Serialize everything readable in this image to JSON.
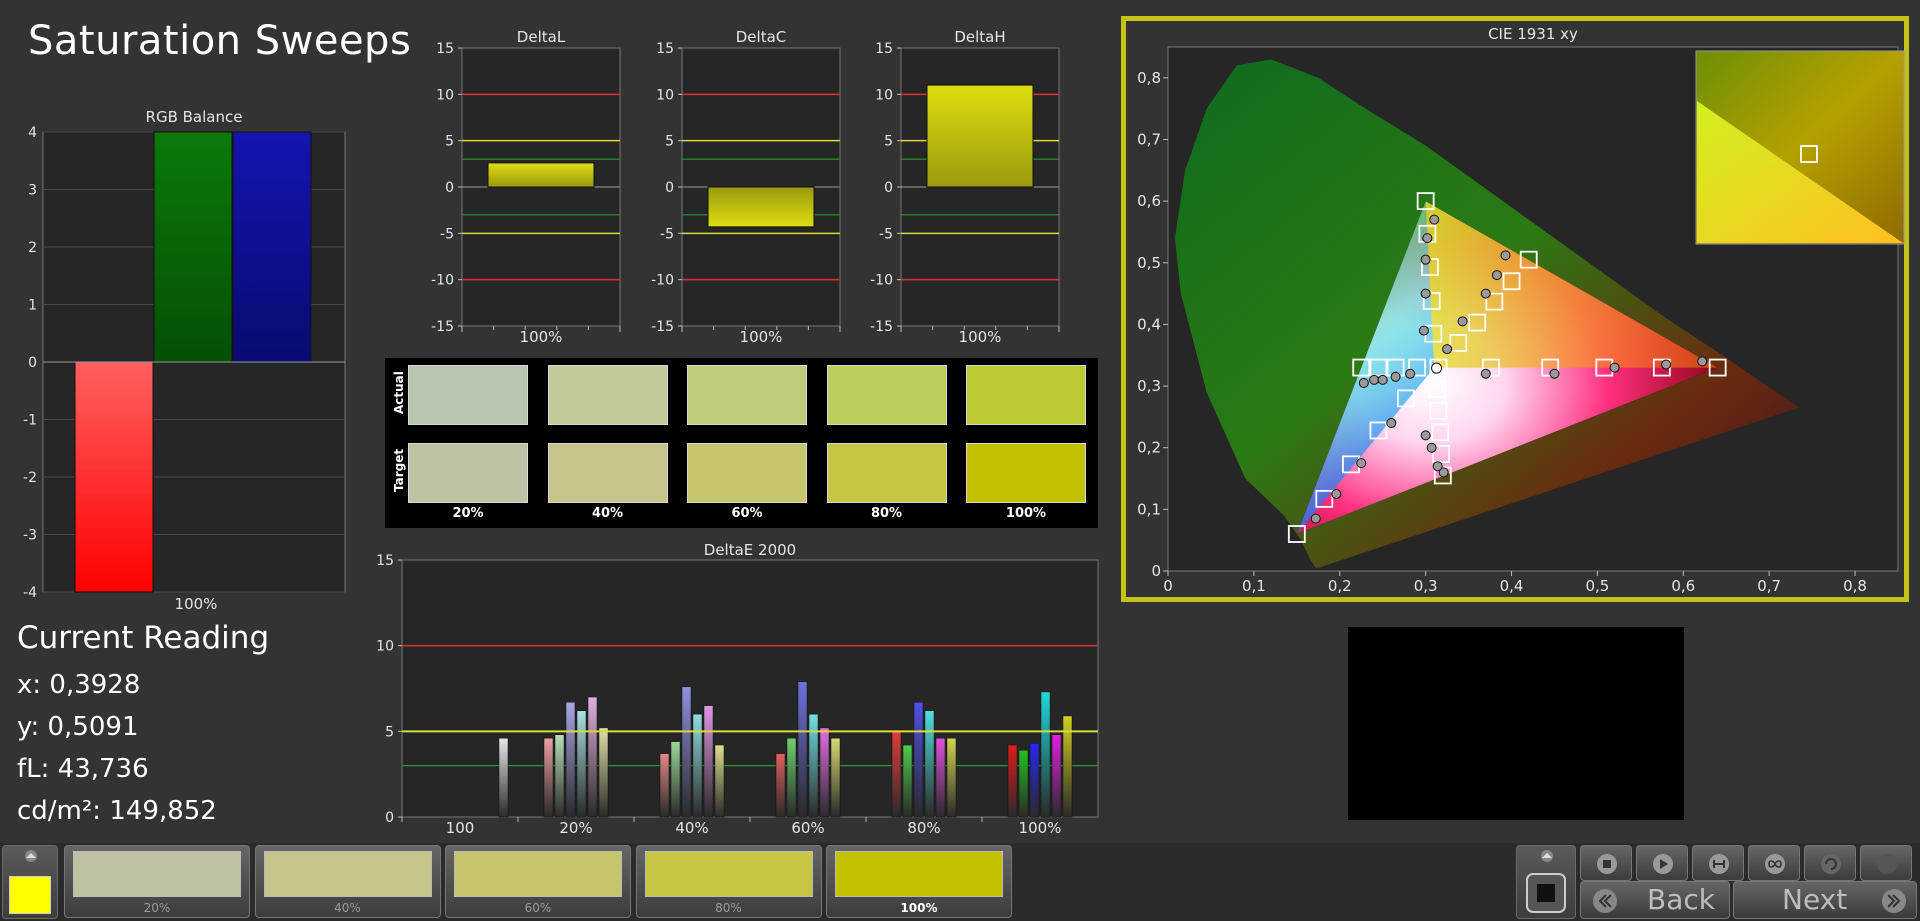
{
  "page": {
    "title": "Saturation Sweeps"
  },
  "colors": {
    "background": "#333333",
    "plot_background": "#262626",
    "red_ref": "#e03030",
    "yellow_ref": "#dada3a",
    "green_ref": "#2a9a2a",
    "target_color": "#c8c800",
    "frame_accent": "#c2c21a"
  },
  "current_reading": {
    "heading": "Current Reading",
    "x": "x: 0,3928",
    "y": "y: 0,5091",
    "fl": "fL: 43,736",
    "cdm2": "cd/m²: 149,852"
  },
  "swatches": {
    "actual_label": "Actual",
    "target_label": "Target",
    "items": [
      {
        "label": "20%",
        "actual": "#b8c5b0",
        "target": "#c0c0a2"
      },
      {
        "label": "40%",
        "actual": "#c0cb97",
        "target": "#c5c58b"
      },
      {
        "label": "60%",
        "actual": "#c1cd7a",
        "target": "#c6c56e"
      },
      {
        "label": "80%",
        "actual": "#bfcd5c",
        "target": "#c6c546"
      },
      {
        "label": "100%",
        "actual": "#bccb34",
        "target": "#c2c200"
      }
    ]
  },
  "bottom_bar": {
    "steps": [
      {
        "label": "20%",
        "color": "#c0c0a2"
      },
      {
        "label": "40%",
        "color": "#c5c58b"
      },
      {
        "label": "60%",
        "color": "#c6c56e"
      },
      {
        "label": "80%",
        "color": "#c6c546"
      },
      {
        "label": "100%",
        "color": "#c2c200"
      }
    ],
    "current_color": "#ffff00",
    "back_label": "Back",
    "next_label": "Next"
  },
  "chart_data": [
    {
      "id": "rgb_balance",
      "type": "bar",
      "title": "RGB Balance",
      "categories": [
        "100%"
      ],
      "series": [
        {
          "color": "#ff2a2a",
          "values": [
            -4
          ]
        },
        {
          "color": "#0b7a0b",
          "values": [
            4
          ]
        },
        {
          "color": "#1010a0",
          "values": [
            4
          ]
        }
      ],
      "ylim": [
        -4,
        4
      ],
      "yticks": [
        "4",
        "3",
        "2",
        "1",
        "0",
        "-1",
        "-2",
        "-3",
        "-4"
      ],
      "grid": true
    },
    {
      "id": "delta_l",
      "type": "bar",
      "title": "DeltaL",
      "categories": [
        "100%"
      ],
      "values": [
        2.6
      ],
      "ylim": [
        -15,
        15
      ],
      "yticks": [
        "15",
        "10",
        "5",
        "0",
        "-5",
        "-10",
        "-15"
      ],
      "reference_lines": {
        "red": [
          10,
          -10
        ],
        "yellow": [
          5,
          -5
        ],
        "green": [
          3,
          -3
        ]
      }
    },
    {
      "id": "delta_c",
      "type": "bar",
      "title": "DeltaC",
      "categories": [
        "100%"
      ],
      "values": [
        -4.3
      ],
      "ylim": [
        -15,
        15
      ],
      "yticks": [
        "15",
        "10",
        "5",
        "0",
        "-5",
        "-10",
        "-15"
      ],
      "reference_lines": {
        "red": [
          10,
          -10
        ],
        "yellow": [
          5,
          -5
        ],
        "green": [
          3,
          -3
        ]
      }
    },
    {
      "id": "delta_h",
      "type": "bar",
      "title": "DeltaH",
      "categories": [
        "100%"
      ],
      "values": [
        11.0
      ],
      "ylim": [
        -15,
        15
      ],
      "yticks": [
        "15",
        "10",
        "5",
        "0",
        "-5",
        "-10",
        "-15"
      ],
      "reference_lines": {
        "red": [
          10,
          -10
        ],
        "yellow": [
          5,
          -5
        ],
        "green": [
          3,
          -3
        ]
      }
    },
    {
      "id": "delta_e_2000",
      "type": "bar",
      "title": "DeltaE 2000",
      "categories": [
        "100",
        "20%",
        "40%",
        "60%",
        "80%",
        "100%"
      ],
      "ylim": [
        0,
        15
      ],
      "yticks": [
        "15",
        "10",
        "5",
        "0"
      ],
      "reference_lines": {
        "red": [
          10
        ],
        "yellow": [
          5
        ],
        "green": [
          3
        ]
      },
      "groups": [
        {
          "bars": [
            {
              "color": "#e8e8e8",
              "value": 4.6
            }
          ]
        },
        {
          "bars": [
            {
              "color": "#e8a0a0",
              "value": 4.6
            },
            {
              "color": "#b8e0b8",
              "value": 4.8
            },
            {
              "color": "#a8a8e8",
              "value": 6.7
            },
            {
              "color": "#a8e0e0",
              "value": 6.2
            },
            {
              "color": "#e0b0e0",
              "value": 7.0
            },
            {
              "color": "#e0e0a8",
              "value": 5.2
            }
          ]
        },
        {
          "bars": [
            {
              "color": "#e08888",
              "value": 3.7
            },
            {
              "color": "#99d899",
              "value": 4.4
            },
            {
              "color": "#9090e0",
              "value": 7.6
            },
            {
              "color": "#90e0e0",
              "value": 6.0
            },
            {
              "color": "#e098e0",
              "value": 6.5
            },
            {
              "color": "#dede90",
              "value": 4.2
            }
          ]
        },
        {
          "bars": [
            {
              "color": "#e06060",
              "value": 3.7
            },
            {
              "color": "#70d070",
              "value": 4.6
            },
            {
              "color": "#7070e0",
              "value": 7.9
            },
            {
              "color": "#70e0e0",
              "value": 6.0
            },
            {
              "color": "#e070e0",
              "value": 5.2
            },
            {
              "color": "#d8d870",
              "value": 4.6
            }
          ]
        },
        {
          "bars": [
            {
              "color": "#e03c3c",
              "value": 5.0
            },
            {
              "color": "#4ccc4c",
              "value": 4.2
            },
            {
              "color": "#5050e8",
              "value": 6.7
            },
            {
              "color": "#50e0e0",
              "value": 6.2
            },
            {
              "color": "#e050e0",
              "value": 4.6
            },
            {
              "color": "#d4d450",
              "value": 4.6
            }
          ]
        },
        {
          "bars": [
            {
              "color": "#dd1c1c",
              "value": 4.2
            },
            {
              "color": "#22c022",
              "value": 3.9
            },
            {
              "color": "#2828f0",
              "value": 4.3
            },
            {
              "color": "#20d8d8",
              "value": 7.3
            },
            {
              "color": "#e020e0",
              "value": 4.8
            },
            {
              "color": "#d0d020",
              "value": 5.9
            }
          ]
        }
      ]
    },
    {
      "id": "cie_1931",
      "type": "scatter",
      "title": "CIE 1931 xy",
      "xlim": [
        0,
        0.85
      ],
      "ylim": [
        0,
        0.85
      ],
      "xticks": [
        "0",
        "0,1",
        "0,2",
        "0,3",
        "0,4",
        "0,5",
        "0,6",
        "0,7",
        "0,8"
      ],
      "yticks": [
        "0",
        "0,1",
        "0,2",
        "0,3",
        "0,4",
        "0,5",
        "0,6",
        "0,7",
        "0,8"
      ],
      "gamut": [
        [
          0.64,
          0.33
        ],
        [
          0.3,
          0.6
        ],
        [
          0.15,
          0.06
        ]
      ],
      "white_point": [
        0.3127,
        0.329
      ],
      "targets": [
        [
          0.3,
          0.6
        ],
        [
          0.302,
          0.547
        ],
        [
          0.305,
          0.493
        ],
        [
          0.307,
          0.438
        ],
        [
          0.309,
          0.385
        ],
        [
          0.64,
          0.33
        ],
        [
          0.575,
          0.33
        ],
        [
          0.508,
          0.33
        ],
        [
          0.445,
          0.33
        ],
        [
          0.376,
          0.33
        ],
        [
          0.15,
          0.06
        ],
        [
          0.182,
          0.117
        ],
        [
          0.213,
          0.173
        ],
        [
          0.245,
          0.228
        ],
        [
          0.277,
          0.28
        ],
        [
          0.225,
          0.33
        ],
        [
          0.245,
          0.33
        ],
        [
          0.265,
          0.33
        ],
        [
          0.29,
          0.33
        ],
        [
          0.315,
          0.33
        ],
        [
          0.42,
          0.505
        ],
        [
          0.4,
          0.47
        ],
        [
          0.38,
          0.437
        ],
        [
          0.36,
          0.403
        ],
        [
          0.338,
          0.37
        ],
        [
          0.32,
          0.155
        ],
        [
          0.318,
          0.19
        ],
        [
          0.317,
          0.225
        ],
        [
          0.315,
          0.26
        ],
        [
          0.314,
          0.295
        ]
      ],
      "measured": [
        [
          0.31,
          0.57
        ],
        [
          0.302,
          0.54
        ],
        [
          0.3,
          0.505
        ],
        [
          0.3,
          0.45
        ],
        [
          0.298,
          0.39
        ],
        [
          0.622,
          0.34
        ],
        [
          0.58,
          0.335
        ],
        [
          0.52,
          0.33
        ],
        [
          0.45,
          0.32
        ],
        [
          0.37,
          0.32
        ],
        [
          0.172,
          0.085
        ],
        [
          0.196,
          0.125
        ],
        [
          0.225,
          0.175
        ],
        [
          0.26,
          0.24
        ],
        [
          0.3,
          0.22
        ],
        [
          0.228,
          0.305
        ],
        [
          0.24,
          0.31
        ],
        [
          0.25,
          0.31
        ],
        [
          0.265,
          0.315
        ],
        [
          0.282,
          0.32
        ],
        [
          0.393,
          0.512
        ],
        [
          0.383,
          0.48
        ],
        [
          0.37,
          0.45
        ],
        [
          0.343,
          0.405
        ],
        [
          0.325,
          0.36
        ],
        [
          0.321,
          0.16
        ],
        [
          0.314,
          0.17
        ],
        [
          0.307,
          0.2
        ]
      ],
      "current": [
        0.3928,
        0.5091
      ],
      "inset_point": [
        0.3928,
        0.5091
      ]
    }
  ]
}
